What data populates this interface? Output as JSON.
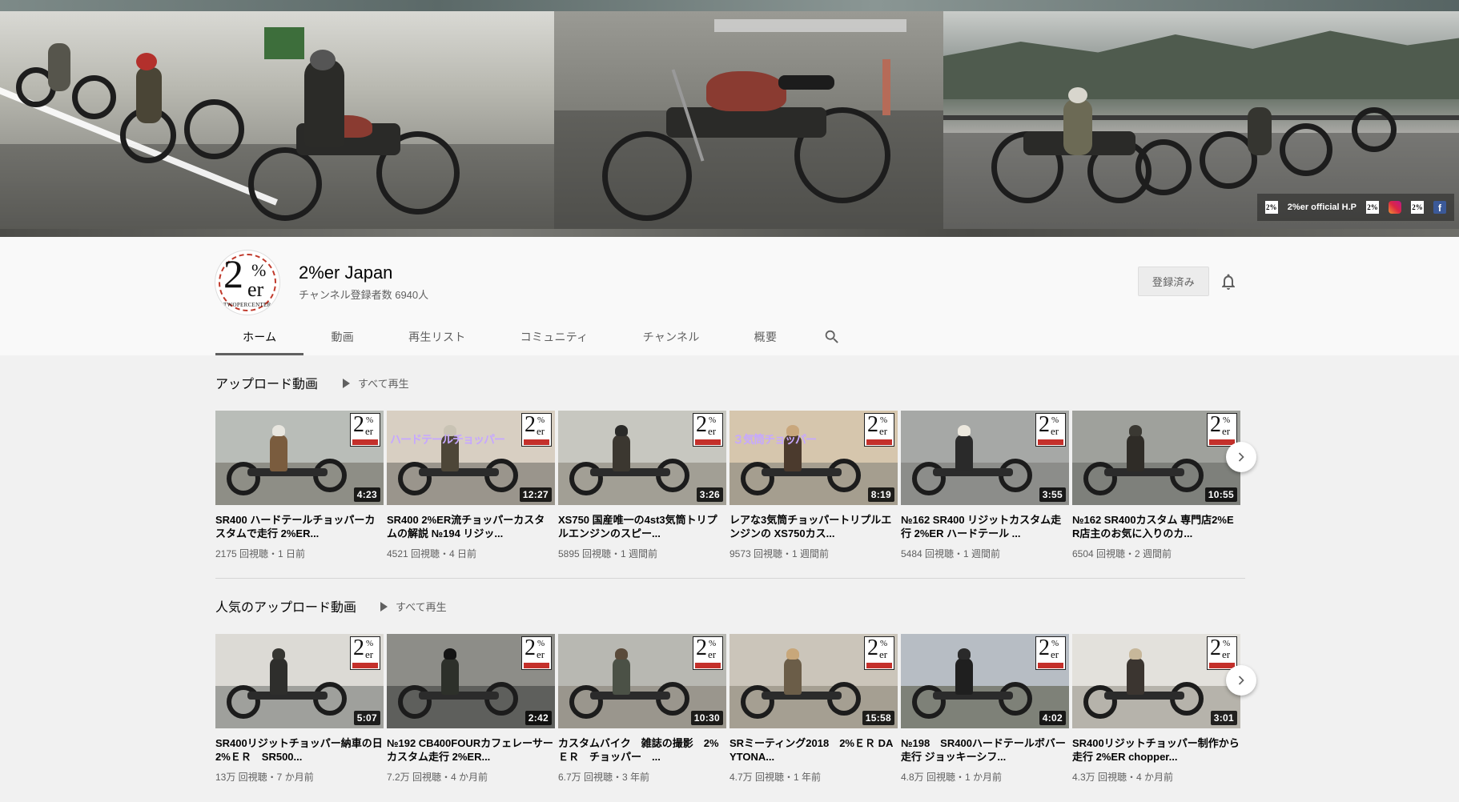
{
  "banner": {
    "link_label": "2%er official H.P",
    "icons": [
      "2er-logo-icon",
      "2er-logo-icon",
      "instagram-icon",
      "2er-logo-icon",
      "facebook-icon"
    ]
  },
  "channel": {
    "name": "2%er Japan",
    "subscribers": "チャンネル登録者数 6940人",
    "subscribe_label": "登録済み",
    "avatar_text": {
      "two": "2",
      "pct": "%",
      "er": "er",
      "sub": "TWOPERCENTER"
    }
  },
  "tabs": [
    {
      "label": "ホーム",
      "active": true
    },
    {
      "label": "動画",
      "active": false
    },
    {
      "label": "再生リスト",
      "active": false
    },
    {
      "label": "コミュニティ",
      "active": false
    },
    {
      "label": "チャンネル",
      "active": false
    },
    {
      "label": "概要",
      "active": false
    }
  ],
  "sections": [
    {
      "title": "アップロード動画",
      "play_all": "すべて再生",
      "videos": [
        {
          "title": "SR400 ハードテールチョッパーカスタムで走行 2%ER...",
          "meta": "2175 回視聴・1 日前",
          "duration": "4:23"
        },
        {
          "title": "SR400 2%ER流チョッパーカスタムの解説 №194 リジッ...",
          "meta": "4521 回視聴・4 日前",
          "duration": "12:27",
          "overlay": "ハードテールチョッパー"
        },
        {
          "title": "XS750 国産唯一の4st3気筒トリプルエンジンのスピー...",
          "meta": "5895 回視聴・1 週間前",
          "duration": "3:26"
        },
        {
          "title": "レアな3気筒チョッパートリプルエンジンの XS750カス...",
          "meta": "9573 回視聴・1 週間前",
          "duration": "8:19",
          "overlay": "３気筒チョッパー"
        },
        {
          "title": "№162 SR400 リジットカスタム走行 2%ER ハードテール ...",
          "meta": "5484 回視聴・1 週間前",
          "duration": "3:55"
        },
        {
          "title": "№162 SR400カスタム 専門店2%ER店主のお気に入りのカ...",
          "meta": "6504 回視聴・2 週間前",
          "duration": "10:55"
        }
      ]
    },
    {
      "title": "人気のアップロード動画",
      "play_all": "すべて再生",
      "videos": [
        {
          "title": "SR400リジットチョッパー納車の日 2%ＥＲ　SR500...",
          "meta": "13万 回視聴・7 か月前",
          "duration": "5:07"
        },
        {
          "title": "№192 CB400FOURカフェレーサーカスタム走行 2%ER...",
          "meta": "7.2万 回視聴・4 か月前",
          "duration": "2:42"
        },
        {
          "title": "カスタムバイク　雑誌の撮影　2%ＥＲ　チョッパー　...",
          "meta": "6.7万 回視聴・3 年前",
          "duration": "10:30"
        },
        {
          "title": "SRミーティング2018　2%ＥＲ DAYTONA...",
          "meta": "4.7万 回視聴・1 年前",
          "duration": "15:58"
        },
        {
          "title": "№198　SR400ハードテールボバー走行 ジョッキーシフ...",
          "meta": "4.8万 回視聴・1 か月前",
          "duration": "4:02"
        },
        {
          "title": "SR400リジットチョッパー制作から走行 2%ER chopper...",
          "meta": "4.3万 回視聴・4 か月前",
          "duration": "3:01"
        }
      ]
    }
  ],
  "colors": {
    "accent_red": "#c4302b",
    "text_secondary": "#606060",
    "page_bg": "#f1f1f1",
    "header_bg": "#f9f9f9"
  }
}
